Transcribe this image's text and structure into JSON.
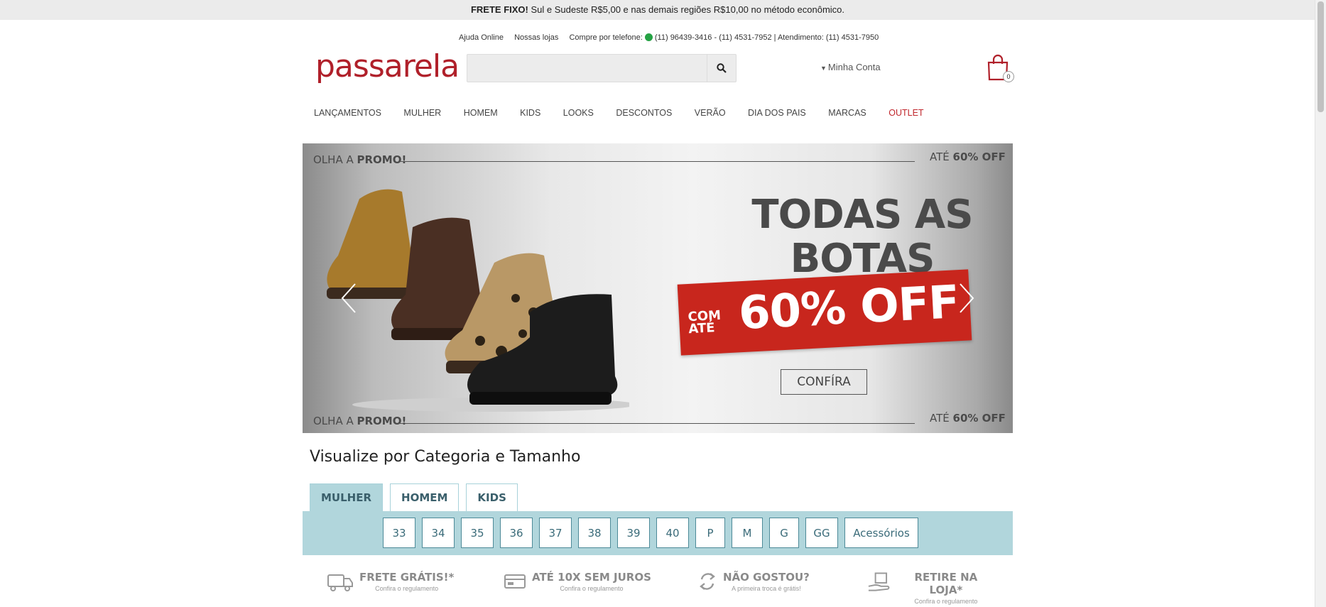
{
  "topbar": {
    "bold": "FRETE FIXO!",
    "text": " Sul e Sudeste R$5,00 e nas demais regiões R$10,00 no método econômico."
  },
  "header": {
    "help": "Ajuda Online",
    "stores": "Nossas lojas",
    "phone_label": "Compre por telefone:",
    "phones": "(11) 96439-3416 - (11) 4531-7952 | Atendimento: (11) 4531-7950",
    "logo": "passarela",
    "search_placeholder": "",
    "account": "Minha Conta",
    "cart_count": "0"
  },
  "nav": {
    "items": [
      "LANÇAMENTOS",
      "MULHER",
      "HOMEM",
      "KIDS",
      "LOOKS",
      "DESCONTOS",
      "VERÃO",
      "DIA DOS PAIS",
      "MARCAS",
      "OUTLET"
    ]
  },
  "banner": {
    "tag_left_plain": "OLHA A ",
    "tag_left_bold": "PROMO!",
    "tag_right_plain": "ATÉ ",
    "tag_right_bold": "60% OFF",
    "headline_1": "TODAS AS",
    "headline_2": "BOTAS",
    "com": "COM",
    "ate": "ATÉ",
    "offer": "60% OFF",
    "cta": "CONFÍRA"
  },
  "category": {
    "title": "Visualize por Categoria e Tamanho",
    "tabs": [
      "MULHER",
      "HOMEM",
      "KIDS"
    ],
    "sizes": [
      "33",
      "34",
      "35",
      "36",
      "37",
      "38",
      "39",
      "40",
      "P",
      "M",
      "G",
      "GG",
      "Acessórios"
    ]
  },
  "benefits": [
    {
      "title": "FRETE GRÁTIS!*",
      "sub": "Confira o regulamento",
      "icon": "truck-icon"
    },
    {
      "title": "ATÉ 10X SEM JUROS",
      "sub": "Confira o regulamento",
      "icon": "card-icon"
    },
    {
      "title": "NÃO GOSTOU?",
      "sub": "A primeira troca é grátis!",
      "icon": "exchange-icon"
    },
    {
      "title": "RETIRE NA LOJA*",
      "sub": "Confira o regulamento",
      "icon": "store-pickup-icon"
    }
  ],
  "colors": {
    "brand": "#b0202a",
    "accent": "#b1d6dc",
    "outlet": "#c0272d"
  }
}
